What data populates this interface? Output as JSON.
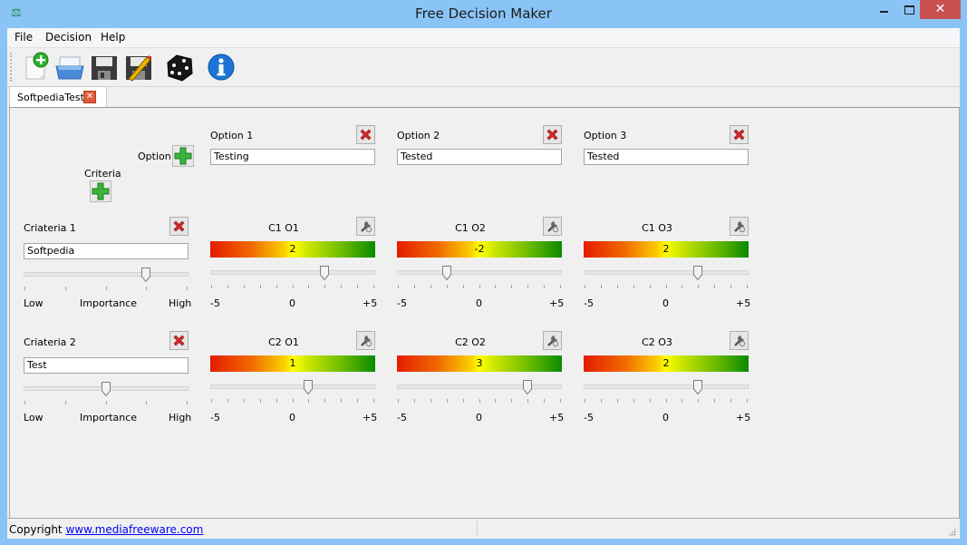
{
  "window": {
    "title": "Free Decision Maker",
    "app_icon": "scales-icon",
    "controls": {
      "minimize": "minimize",
      "maximize": "maximize",
      "close": "✕"
    }
  },
  "menu": {
    "items": [
      "File",
      "Decision",
      "Help"
    ]
  },
  "toolbar": {
    "buttons": [
      {
        "name": "new-document-icon",
        "tooltip": "New"
      },
      {
        "name": "open-icon",
        "tooltip": "Open"
      },
      {
        "name": "save-icon",
        "tooltip": "Save"
      },
      {
        "name": "save-as-icon",
        "tooltip": "Save As"
      },
      {
        "name": "dice-icon",
        "tooltip": "Decide"
      },
      {
        "name": "info-icon",
        "tooltip": "About"
      }
    ]
  },
  "tabs": [
    {
      "label": "SoftpediaTest",
      "close": "✕"
    }
  ],
  "matrix": {
    "add_option_label": "Option",
    "add_criteria_label": "Criteria",
    "options": [
      {
        "label": "Option 1",
        "value": "Testing"
      },
      {
        "label": "Option 2",
        "value": "Tested"
      },
      {
        "label": "Option 3",
        "value": "Tested"
      }
    ],
    "importance_labels": {
      "low": "Low",
      "mid": "Importance",
      "high": "High"
    },
    "score_labels": {
      "min": "-5",
      "mid": "0",
      "max": "+5"
    },
    "score_range": [
      -5,
      5
    ],
    "importance_range": [
      0,
      4
    ],
    "criteria": [
      {
        "label": "Criateria 1",
        "value": "Softpedia",
        "importance": 3,
        "scores": [
          {
            "label": "C1 O1",
            "value": 2,
            "display": "2"
          },
          {
            "label": "C1 O2",
            "value": -2,
            "display": "-2"
          },
          {
            "label": "C1 O3",
            "value": 2,
            "display": "2"
          }
        ]
      },
      {
        "label": "Criateria 2",
        "value": "Test",
        "importance": 2,
        "scores": [
          {
            "label": "C2 O1",
            "value": 1,
            "display": "1"
          },
          {
            "label": "C2 O2",
            "value": 3,
            "display": "3"
          },
          {
            "label": "C2 O3",
            "value": 2,
            "display": "2"
          }
        ]
      }
    ]
  },
  "status": {
    "prefix": "Copyright",
    "link": "www.mediafreeware.com"
  },
  "colors": {
    "titlebar": "#8ac4f6",
    "close_button": "#c75050",
    "meter_low": "#e51c00",
    "meter_mid": "#ffff00",
    "meter_high": "#0a8a00",
    "link": "#0000ff"
  }
}
